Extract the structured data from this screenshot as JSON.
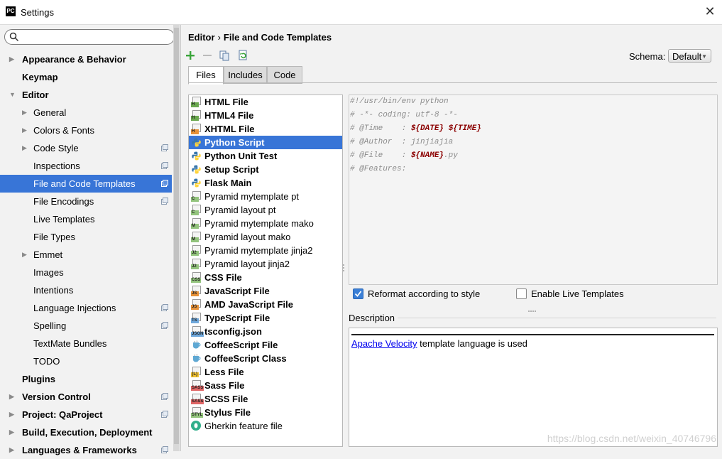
{
  "window": {
    "title": "Settings",
    "app_icon_text": "PC",
    "close": "✕"
  },
  "search": {
    "placeholder": ""
  },
  "sidebar": {
    "items": [
      {
        "label": "Appearance & Behavior",
        "level": 0,
        "arrow": "▶"
      },
      {
        "label": "Keymap",
        "level": 0
      },
      {
        "label": "Editor",
        "level": 0,
        "arrow": "▼"
      },
      {
        "label": "General",
        "level": 1,
        "arrow": "▶"
      },
      {
        "label": "Colors & Fonts",
        "level": 1,
        "arrow": "▶"
      },
      {
        "label": "Code Style",
        "level": 1,
        "arrow": "▶",
        "project": true
      },
      {
        "label": "Inspections",
        "level": 1,
        "project": true
      },
      {
        "label": "File and Code Templates",
        "level": 1,
        "project": true,
        "selected": true
      },
      {
        "label": "File Encodings",
        "level": 1,
        "project": true
      },
      {
        "label": "Live Templates",
        "level": 1
      },
      {
        "label": "File Types",
        "level": 1
      },
      {
        "label": "Emmet",
        "level": 1,
        "arrow": "▶"
      },
      {
        "label": "Images",
        "level": 1
      },
      {
        "label": "Intentions",
        "level": 1
      },
      {
        "label": "Language Injections",
        "level": 1,
        "project": true
      },
      {
        "label": "Spelling",
        "level": 1,
        "project": true
      },
      {
        "label": "TextMate Bundles",
        "level": 1
      },
      {
        "label": "TODO",
        "level": 1
      },
      {
        "label": "Plugins",
        "level": 0
      },
      {
        "label": "Version Control",
        "level": 0,
        "arrow": "▶",
        "project": true
      },
      {
        "label": "Project: QaProject",
        "level": 0,
        "arrow": "▶",
        "project": true
      },
      {
        "label": "Build, Execution, Deployment",
        "level": 0,
        "arrow": "▶"
      },
      {
        "label": "Languages & Frameworks",
        "level": 0,
        "arrow": "▶",
        "project": true
      }
    ]
  },
  "breadcrumb": {
    "parent": "Editor",
    "separator": "›",
    "current": "File and Code Templates"
  },
  "toolbar": {
    "icons": [
      "add-icon",
      "remove-icon",
      "copy-icon",
      "reset-icon"
    ]
  },
  "schema": {
    "label": "Schema:",
    "value": "Default"
  },
  "tabs": [
    {
      "label": "Files",
      "active": true
    },
    {
      "label": "Includes"
    },
    {
      "label": "Code"
    }
  ],
  "files": [
    {
      "label": "HTML File",
      "bold": true,
      "icon": "H",
      "color": "#6aa84f"
    },
    {
      "label": "HTML4 File",
      "bold": true,
      "icon": "H",
      "color": "#6aa84f"
    },
    {
      "label": "XHTML File",
      "bold": true,
      "icon": "H",
      "color": "#e69138"
    },
    {
      "label": "Python Script",
      "bold": true,
      "icon": "python",
      "selected": true
    },
    {
      "label": "Python Unit Test",
      "bold": true,
      "icon": "python"
    },
    {
      "label": "Setup Script",
      "bold": true,
      "icon": "python"
    },
    {
      "label": "Flask Main",
      "bold": true,
      "icon": "python"
    },
    {
      "label": "Pyramid mytemplate pt",
      "icon": "C",
      "color": "#93c47d"
    },
    {
      "label": "Pyramid layout pt",
      "icon": "C",
      "color": "#93c47d"
    },
    {
      "label": "Pyramid mytemplate mako",
      "icon": "M",
      "color": "#93c47d"
    },
    {
      "label": "Pyramid layout mako",
      "icon": "M",
      "color": "#93c47d"
    },
    {
      "label": "Pyramid mytemplate jinja2",
      "icon": "J2",
      "color": "#93c47d"
    },
    {
      "label": "Pyramid layout jinja2",
      "icon": "J2",
      "color": "#93c47d"
    },
    {
      "label": "CSS File",
      "bold": true,
      "icon": "CSS",
      "color": "#93c47d"
    },
    {
      "label": "JavaScript File",
      "bold": true,
      "icon": "JS",
      "color": "#e69138"
    },
    {
      "label": "AMD JavaScript File",
      "bold": true,
      "icon": "JS",
      "color": "#e69138"
    },
    {
      "label": "TypeScript File",
      "bold": true,
      "icon": "TS",
      "color": "#6fa8dc"
    },
    {
      "label": "tsconfig.json",
      "bold": true,
      "icon": "JSON",
      "color": "#6fa8dc"
    },
    {
      "label": "CoffeeScript File",
      "bold": true,
      "icon": "coffee"
    },
    {
      "label": "CoffeeScript Class",
      "bold": true,
      "icon": "coffee"
    },
    {
      "label": "Less File",
      "bold": true,
      "icon": "{L}",
      "color": "#f1c232"
    },
    {
      "label": "Sass File",
      "bold": true,
      "icon": "SASS",
      "color": "#e06666"
    },
    {
      "label": "SCSS File",
      "bold": true,
      "icon": "SASS",
      "color": "#e06666"
    },
    {
      "label": "Stylus File",
      "bold": true,
      "icon": "STYL",
      "color": "#93c47d"
    },
    {
      "label": "Gherkin feature file",
      "icon": "gherkin"
    }
  ],
  "editor": {
    "lines": [
      [
        {
          "t": "#!/usr/bin/env python"
        }
      ],
      [
        {
          "t": "# -*- coding: utf-8 -*-"
        }
      ],
      [
        {
          "t": "# @Time    : "
        },
        {
          "t": "${DATE}",
          "v": true
        },
        {
          "t": " "
        },
        {
          "t": "${TIME}",
          "v": true
        }
      ],
      [
        {
          "t": "# @Author  : jinjiajia"
        }
      ],
      [
        {
          "t": "# @File    : "
        },
        {
          "t": "${NAME}",
          "v": true
        },
        {
          "t": ".py"
        }
      ],
      [
        {
          "t": "# @Features:"
        }
      ]
    ]
  },
  "options": {
    "reformat": {
      "label": "Reformat according to style",
      "checked": true
    },
    "live_templates": {
      "label": "Enable Live Templates",
      "checked": false
    }
  },
  "description": {
    "label": "Description",
    "link": "Apache Velocity",
    "text": " template language is used"
  },
  "watermark": "https://blog.csdn.net/weixin_40746796",
  "colors": {
    "selection": "#3875d7",
    "template_var": "#8b0000",
    "link": "#0000ee"
  }
}
